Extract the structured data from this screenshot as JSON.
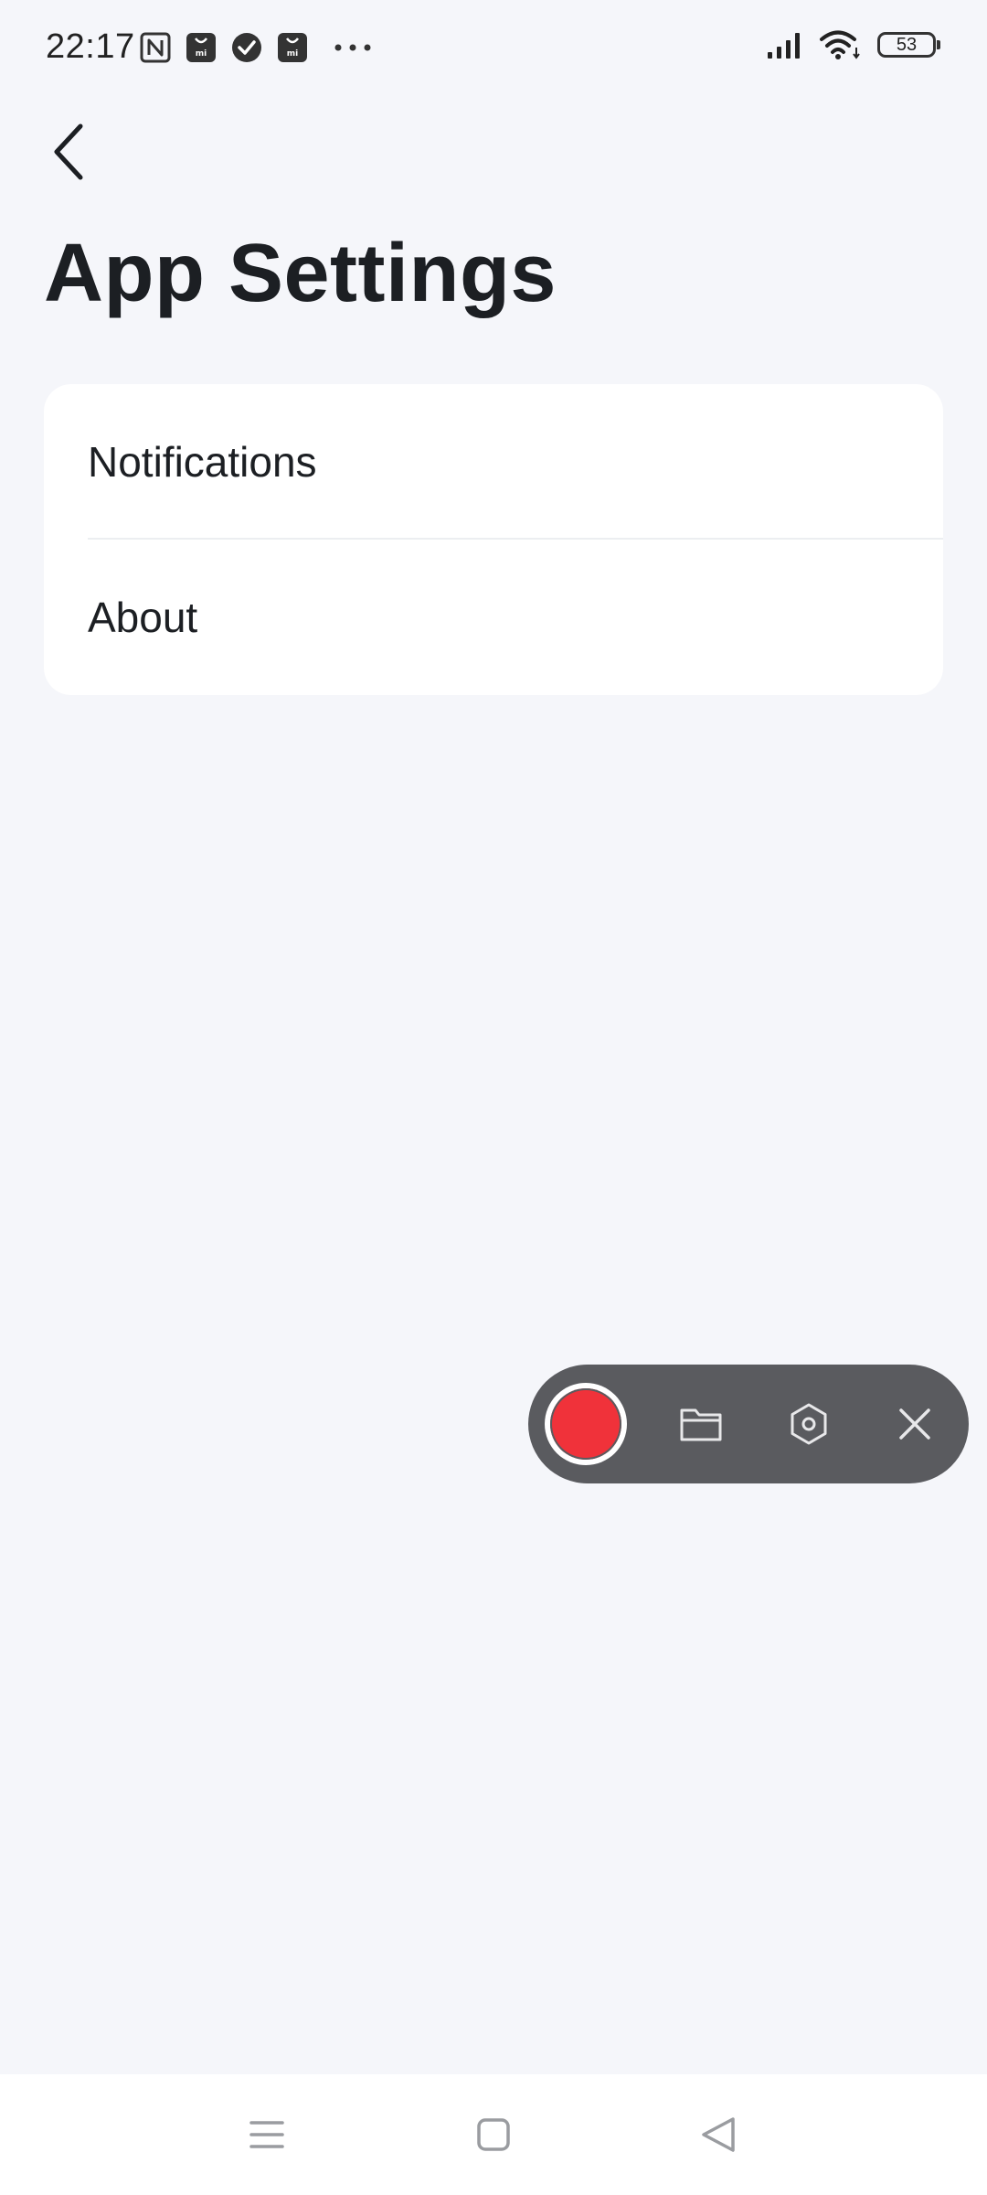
{
  "status_bar": {
    "time": "22:17",
    "battery": "53",
    "left_icons": [
      "nfc-icon",
      "mi-store-icon",
      "check-circle-icon",
      "mi-store-icon",
      "more-dots-icon"
    ],
    "right_icons": [
      "signal-icon",
      "wifi-icon",
      "battery-icon"
    ]
  },
  "header": {
    "back_icon": "chevron-left-icon",
    "title": "App Settings"
  },
  "settings": {
    "items": [
      {
        "label": "Notifications"
      },
      {
        "label": "About"
      }
    ]
  },
  "recorder": {
    "record_color": "#f0323a",
    "bar_color": "#5a5b5f",
    "icons": [
      "record-icon",
      "folder-icon",
      "hexagon-settings-icon",
      "close-icon"
    ]
  },
  "nav_bar": {
    "icons": [
      "menu-icon",
      "home-square-icon",
      "back-triangle-icon"
    ]
  },
  "colors": {
    "background": "#f5f6fa",
    "card": "#ffffff",
    "text": "#1c1f23"
  }
}
